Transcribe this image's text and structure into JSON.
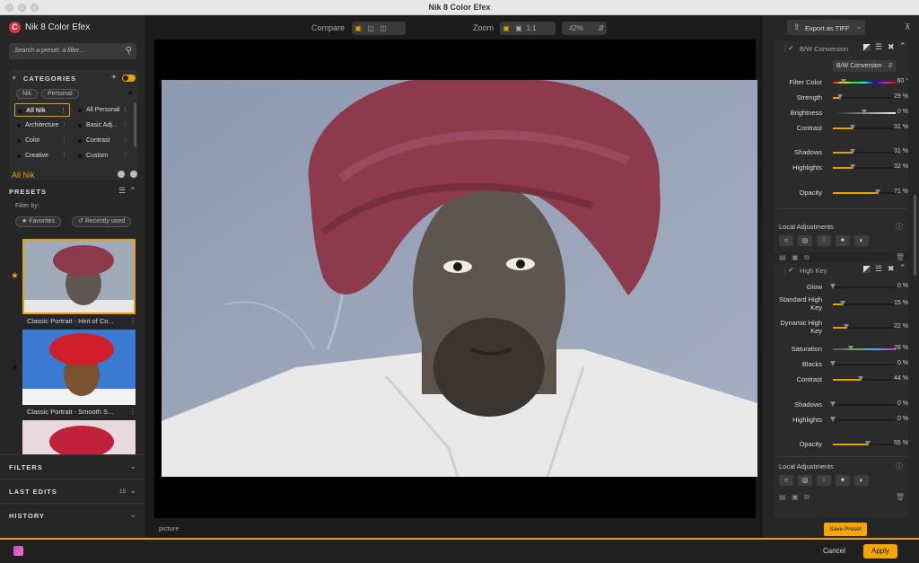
{
  "window": {
    "title": "Nik 8 Color Efex"
  },
  "app": {
    "logo": "C",
    "name": "Nik 8 Color Efex"
  },
  "search": {
    "placeholder": "Search a preset, a filter..."
  },
  "categories": {
    "title": "CATEGORIES",
    "tags": [
      "Nik",
      "Personal"
    ],
    "items": [
      {
        "label": "All Nik"
      },
      {
        "label": "All Personal"
      },
      {
        "label": "Architecture"
      },
      {
        "label": "Basic Adj..."
      },
      {
        "label": "Color"
      },
      {
        "label": "Contrast"
      },
      {
        "label": "Creative"
      },
      {
        "label": "Custom"
      }
    ]
  },
  "selected_category": "All Nik",
  "presets": {
    "title": "PRESETS",
    "filter_by": "Filter by:",
    "favorites_label": "Favorites",
    "recent_label": "Recently used",
    "items": [
      {
        "label": "Classic Portrait - Hint of Co..."
      },
      {
        "label": "Classic Portrait - Smooth S..."
      }
    ]
  },
  "sections": {
    "filters": "FILTERS",
    "last_edits": "LAST EDITS",
    "last_edits_count": "15",
    "history": "HISTORY"
  },
  "toolbar": {
    "compare_label": "Compare",
    "zoom_label": "Zoom",
    "zoom_1to1": "1:1",
    "zoom_value": "42%"
  },
  "canvas": {
    "filename": "picture"
  },
  "export": {
    "label": "Export as TIFF"
  },
  "bw_filter": {
    "name": "B/W Conversion",
    "dropdown": "B/W Conversion",
    "sliders": [
      {
        "label": "Filter Color",
        "value": "60 °",
        "level": 0.17
      },
      {
        "label": "Strength",
        "value": "29 %",
        "level": 0.12
      },
      {
        "label": "Brightness",
        "value": "0 %",
        "level": 0.5
      },
      {
        "label": "Contrast",
        "value": "31 %",
        "level": 0.31
      },
      {
        "label": "Shadows",
        "value": "31 %",
        "level": 0.31
      },
      {
        "label": "Highlights",
        "value": "32 %",
        "level": 0.32
      },
      {
        "label": "Opacity",
        "value": "71 %",
        "level": 0.71
      }
    ],
    "local_adjustments": "Local Adjustments"
  },
  "highkey_filter": {
    "name": "High Key",
    "sliders": [
      {
        "label": "Glow",
        "value": "0 %",
        "level": 0.0
      },
      {
        "label": "Standard High Key",
        "value": "15 %",
        "level": 0.15
      },
      {
        "label": "Dynamic High Key",
        "value": "22 %",
        "level": 0.22
      },
      {
        "label": "Saturation",
        "value": "28 %",
        "level": 0.28
      },
      {
        "label": "Blacks",
        "value": "0 %",
        "level": 0.0
      },
      {
        "label": "Contrast",
        "value": "44 %",
        "level": 0.44
      },
      {
        "label": "Shadows",
        "value": "0 %",
        "level": 0.0
      },
      {
        "label": "Highlights",
        "value": "0 %",
        "level": 0.0
      },
      {
        "label": "Opacity",
        "value": "55 %",
        "level": 0.55
      }
    ],
    "local_adjustments": "Local Adjustments"
  },
  "actions": {
    "save_preset": "Save Preset",
    "cancel": "Cancel",
    "apply": "Apply"
  },
  "colors": {
    "accent": "#e5a300",
    "logo_red": "#e0313f"
  }
}
